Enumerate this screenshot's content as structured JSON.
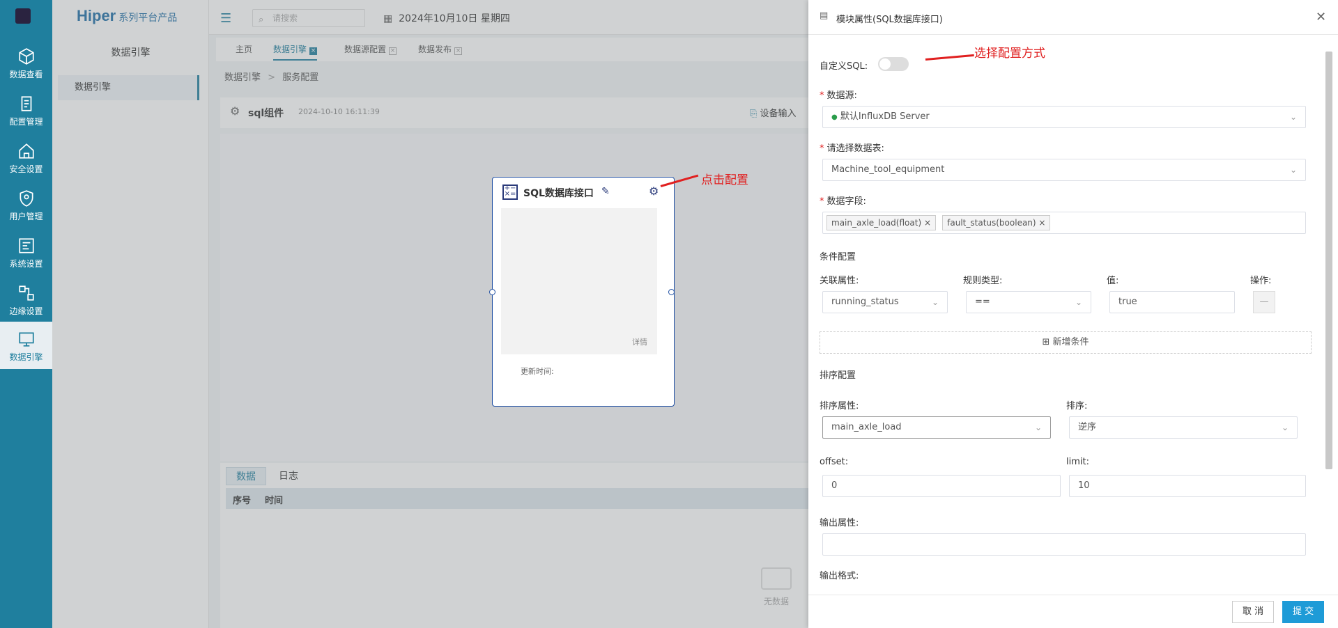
{
  "rail": {
    "items": [
      {
        "label": "数据查看",
        "icon": "cube-icon"
      },
      {
        "label": "配置管理",
        "icon": "config-icon"
      },
      {
        "label": "安全设置",
        "icon": "home-shield-icon"
      },
      {
        "label": "用户管理",
        "icon": "shield-icon"
      },
      {
        "label": "系统设置",
        "icon": "system-icon"
      },
      {
        "label": "边缘设置",
        "icon": "edge-icon"
      },
      {
        "label": "数据引擎",
        "icon": "engine-icon"
      }
    ]
  },
  "sidebar": {
    "brand": "Hiper",
    "brand_sub": "系列平台产品",
    "title": "数据引擎",
    "item": "数据引擎"
  },
  "topbar": {
    "search_placeholder": "请搜索",
    "date": "2024年10月10日 星期四"
  },
  "tabs": [
    {
      "label": "主页"
    },
    {
      "label": "数据引擎"
    },
    {
      "label": "数据源配置"
    },
    {
      "label": "数据发布"
    }
  ],
  "breadcrumb": {
    "root": "数据引擎",
    "sep": ">",
    "current": "服务配置"
  },
  "card": {
    "title": "sql组件",
    "timestamp": "2024-10-10 16:11:39",
    "device_input": "设备输入"
  },
  "node": {
    "title": "SQL数据库接口",
    "detail": "详情",
    "updated": "更新时间:"
  },
  "annotations": {
    "click_config": "点击配置",
    "choose_mode": "选择配置方式"
  },
  "bottom": {
    "tabs": [
      "数据",
      "日志"
    ],
    "columns": [
      "序号",
      "时间"
    ],
    "empty": "无数据"
  },
  "drawer": {
    "title": "模块属性(SQL数据库接口)",
    "custom_sql_label": "自定义SQL:",
    "datasource_label": "数据源:",
    "datasource_value": "默认InfluxDB Server",
    "table_label": "请选择数据表:",
    "table_value": "Machine_tool_equipment",
    "fields_label": "数据字段:",
    "fields": [
      "main_axle_load(float)",
      "fault_status(boolean)"
    ],
    "condition_section": "条件配置",
    "cond_attr_label": "关联属性:",
    "cond_rule_label": "规则类型:",
    "cond_value_label": "值:",
    "cond_op_label": "操作:",
    "cond_attr_value": "running_status",
    "cond_rule_value": "==",
    "cond_value": "true",
    "add_condition": "新增条件",
    "sort_section": "排序配置",
    "sort_attr_label": "排序属性:",
    "sort_attr_value": "main_axle_load",
    "sort_label": "排序:",
    "sort_value": "逆序",
    "offset_label": "offset:",
    "offset_value": "0",
    "limit_label": "limit:",
    "limit_value": "10",
    "output_attr_label": "输出属性:",
    "output_format_label": "输出格式:",
    "cancel": "取 消",
    "submit": "提 交"
  }
}
